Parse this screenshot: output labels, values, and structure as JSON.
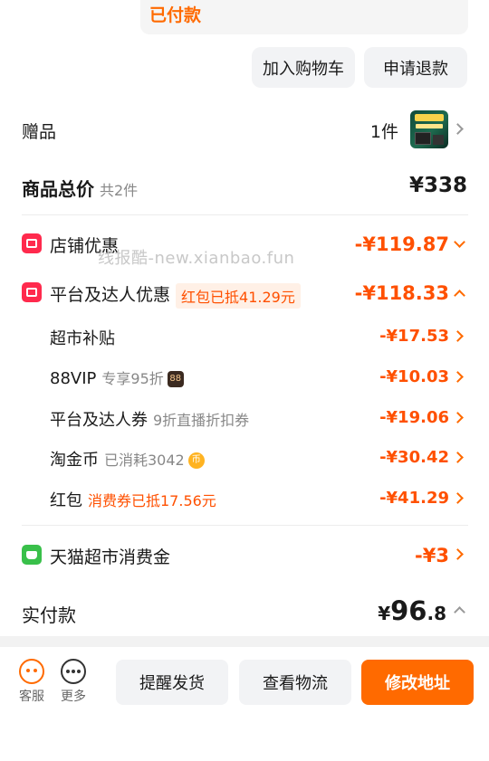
{
  "status": {
    "label": "已付款"
  },
  "actions_top": {
    "cart": "加入购物车",
    "refund": "申请退款"
  },
  "gift": {
    "label": "赠品",
    "count": "1件"
  },
  "goods_total": {
    "label": "商品总价",
    "sub": "共2件",
    "price": "¥338"
  },
  "watermark": "线报酷-new.xianbao.fun",
  "shop_discount": {
    "label": "店铺优惠",
    "amount": "-¥119.87"
  },
  "platform_discount": {
    "label": "平台及达人优惠",
    "tag": "红包已抵41.29元",
    "amount": "-¥118.33",
    "items": [
      {
        "label": "超市补贴",
        "note": "",
        "amount": "-¥17.53"
      },
      {
        "label": "88VIP",
        "note": "专享95折",
        "badge": "88",
        "amount": "-¥10.03"
      },
      {
        "label": "平台及达人券",
        "note": "9折直播折扣券",
        "amount": "-¥19.06"
      },
      {
        "label": "淘金币",
        "note": "已消耗3042",
        "badge": "币",
        "amount": "-¥30.42"
      },
      {
        "label": "红包",
        "note": "消费券已抵17.56元",
        "amount": "-¥41.29"
      }
    ]
  },
  "tmall_fund": {
    "label": "天猫超市消费金",
    "amount": "-¥3"
  },
  "paid": {
    "label": "实付款",
    "currency": "¥",
    "integer": "96",
    "decimal": ".8"
  },
  "bottom_nav": {
    "service": "客服",
    "more": "更多"
  },
  "bottom_actions": {
    "remind": "提醒发货",
    "logistics": "查看物流",
    "address": "修改地址"
  },
  "colors": {
    "accent": "#ff6a00",
    "discount": "#ff5000",
    "shop_icon": "#ff2a4d",
    "tmall_icon": "#39c04a"
  }
}
